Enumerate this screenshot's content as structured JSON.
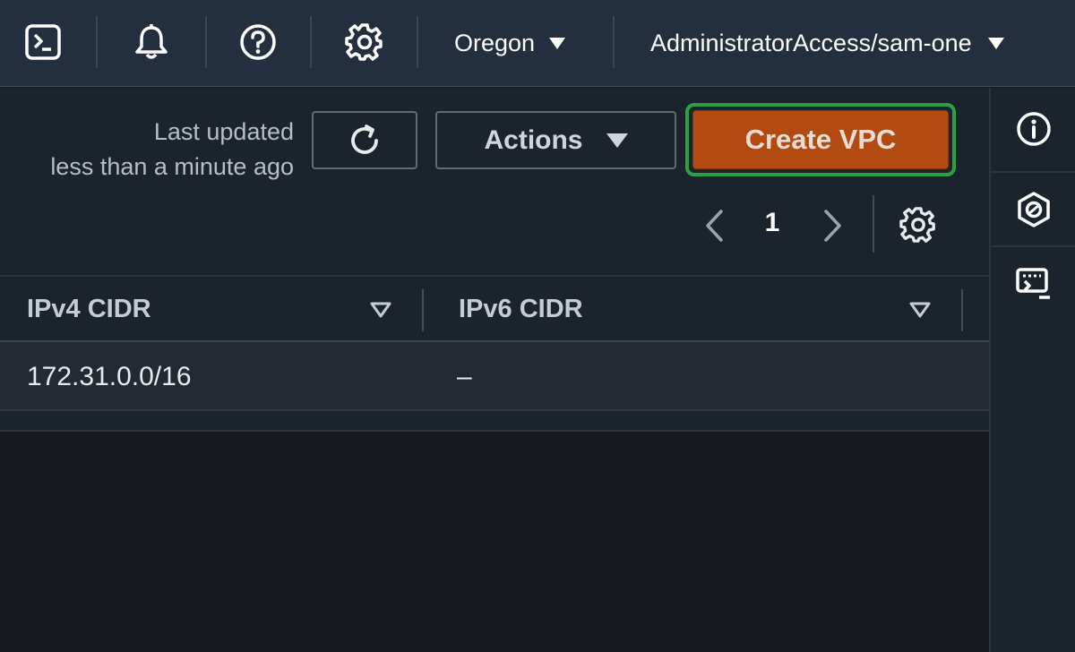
{
  "topnav": {
    "cloudshell_icon": "terminal-icon",
    "notifications_icon": "bell-icon",
    "help_icon": "question-circle-icon",
    "settings_icon": "gear-icon",
    "region": "Oregon",
    "account": "AdministratorAccess/sam-one",
    "bg_color": "#232f3e"
  },
  "toolbar": {
    "last_updated_line1": "Last updated",
    "last_updated_line2": "less than a minute ago",
    "refresh_icon": "refresh-icon",
    "actions_label": "Actions",
    "create_label": "Create VPC",
    "create_color": "#b24a12",
    "focus_color": "#2ea043"
  },
  "pagination": {
    "current_page": "1",
    "prev_icon": "chevron-left-icon",
    "next_icon": "chevron-right-icon",
    "preferences_icon": "gear-icon"
  },
  "table": {
    "columns": [
      {
        "label": "IPv4 CIDR"
      },
      {
        "label": "IPv6 CIDR"
      }
    ],
    "rows": [
      {
        "ipv4_cidr": "172.31.0.0/16",
        "ipv6_cidr": "–"
      }
    ]
  },
  "rail": {
    "items": [
      {
        "icon": "info-icon"
      },
      {
        "icon": "hexagon-icon"
      },
      {
        "icon": "feedback-terminal-icon"
      }
    ]
  }
}
